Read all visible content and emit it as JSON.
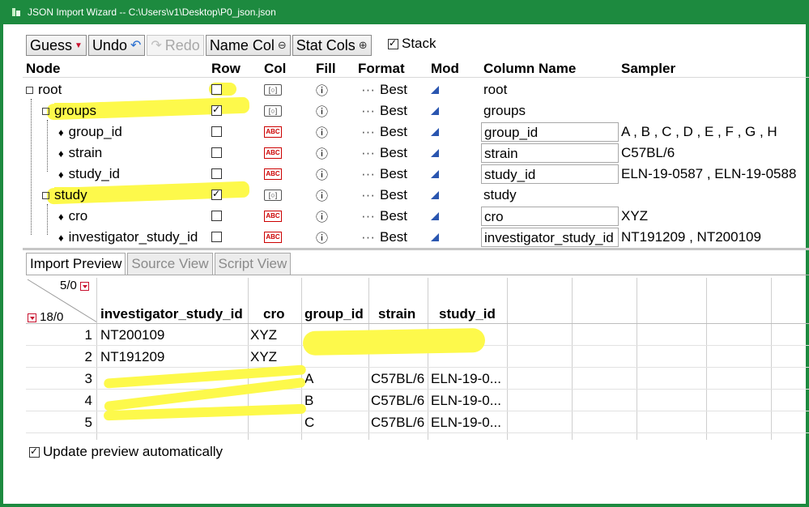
{
  "window": {
    "title": "JSON Import Wizard -- C:\\Users\\v1\\Desktop\\P0_json.json",
    "accent": "#1d8a3f",
    "highlight": "#fdf94b"
  },
  "toolbar": {
    "guess_label": "Guess",
    "undo_label": "Undo",
    "redo_label": "Redo",
    "name_col_label": "Name Col",
    "stat_cols_label": "Stat Cols",
    "stack_label": "Stack",
    "stack_checked": true
  },
  "tree": {
    "headers": {
      "node": "Node",
      "row": "Row",
      "col": "Col",
      "fill": "Fill",
      "format": "Format",
      "mod": "Mod",
      "column_name": "Column Name",
      "sampler": "Sampler"
    },
    "rows": [
      {
        "node": "root",
        "depth": 0,
        "kind": "object",
        "row_checked": false,
        "col_icon": "container-icon",
        "format": "Best",
        "column_name": "root",
        "column_name_editable": false,
        "sampler": ""
      },
      {
        "node": "groups",
        "depth": 1,
        "kind": "object",
        "row_checked": true,
        "col_icon": "container-icon",
        "format": "Best",
        "column_name": "groups",
        "column_name_editable": false,
        "sampler": ""
      },
      {
        "node": "group_id",
        "depth": 2,
        "kind": "value",
        "row_checked": false,
        "col_icon": "abc-icon",
        "format": "Best",
        "column_name": "group_id",
        "column_name_editable": true,
        "sampler": "A , B , C , D , E , F , G , H"
      },
      {
        "node": "strain",
        "depth": 2,
        "kind": "value",
        "row_checked": false,
        "col_icon": "abc-icon",
        "format": "Best",
        "column_name": "strain",
        "column_name_editable": true,
        "sampler": "C57BL/6"
      },
      {
        "node": "study_id",
        "depth": 2,
        "kind": "value",
        "row_checked": false,
        "col_icon": "abc-icon",
        "format": "Best",
        "column_name": "study_id",
        "column_name_editable": true,
        "sampler": "ELN-19-0587 , ELN-19-0588"
      },
      {
        "node": "study",
        "depth": 1,
        "kind": "object",
        "row_checked": true,
        "col_icon": "container-icon",
        "format": "Best",
        "column_name": "study",
        "column_name_editable": false,
        "sampler": ""
      },
      {
        "node": "cro",
        "depth": 2,
        "kind": "value",
        "row_checked": false,
        "col_icon": "abc-icon",
        "format": "Best",
        "column_name": "cro",
        "column_name_editable": true,
        "sampler": "XYZ"
      },
      {
        "node": "investigator_study_id",
        "depth": 2,
        "kind": "value",
        "row_checked": false,
        "col_icon": "abc-icon",
        "format": "Best",
        "column_name": "investigator_study_id",
        "column_name_editable": true,
        "sampler": "NT191209 , NT200109"
      }
    ]
  },
  "tabs": [
    {
      "label": "Import Preview",
      "active": true
    },
    {
      "label": "Source View",
      "active": false
    },
    {
      "label": "Script View",
      "active": false
    }
  ],
  "preview": {
    "cols_count": "5/0",
    "rows_count": "18/0",
    "columns": [
      "investigator_study_id",
      "cro",
      "group_id",
      "strain",
      "study_id"
    ],
    "rows": [
      {
        "n": "1",
        "cells": [
          "NT200109",
          "XYZ",
          "",
          "",
          ""
        ]
      },
      {
        "n": "2",
        "cells": [
          "NT191209",
          "XYZ",
          "",
          "",
          ""
        ]
      },
      {
        "n": "3",
        "cells": [
          "",
          "",
          "A",
          "C57BL/6",
          "ELN-19-0..."
        ]
      },
      {
        "n": "4",
        "cells": [
          "",
          "",
          "B",
          "C57BL/6",
          "ELN-19-0..."
        ]
      },
      {
        "n": "5",
        "cells": [
          "",
          "",
          "C",
          "C57BL/6",
          "ELN-19-0..."
        ]
      }
    ]
  },
  "footer": {
    "update_label": "Update preview automatically",
    "update_checked": true
  }
}
